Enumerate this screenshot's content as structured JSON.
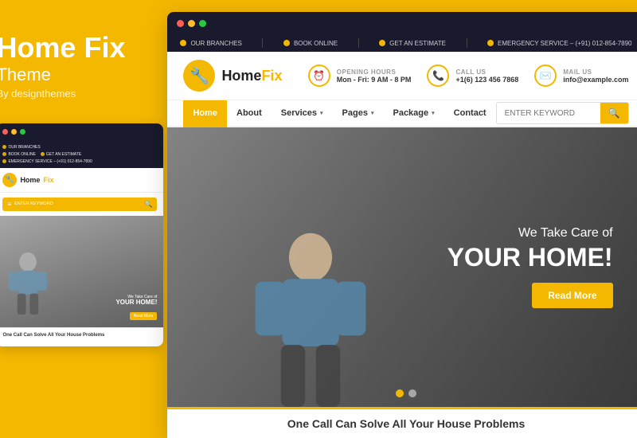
{
  "background_color": "#F5B800",
  "left": {
    "title": "Home Fix",
    "subtitle": "Theme",
    "by": "By designthemes"
  },
  "mini_browser": {
    "topbar": {
      "items": [
        {
          "icon": "location-icon",
          "text": "OUR BRANCHES"
        },
        {
          "icon": "book-icon",
          "text": "BOOK ONLINE"
        },
        {
          "icon": "estimate-icon",
          "text": "GET AN ESTIMATE"
        },
        {
          "icon": "emergency-icon",
          "text": "EMERGENCY SERVICE – (+91) 012-854-7890"
        }
      ]
    },
    "logo": "HomeFix",
    "search_placeholder": "ENTER KEYWORD",
    "hero": {
      "small": "We Take Care of",
      "big": "YOUR HOME!",
      "btn": "Read More"
    },
    "bottom": "One Call Can Solve All Your House Problems"
  },
  "browser": {
    "topbar": {
      "items": [
        {
          "icon": "location-icon",
          "label": "OUR BRANCHES"
        },
        {
          "icon": "book-icon",
          "label": "BOOK ONLINE"
        },
        {
          "icon": "estimate-icon",
          "label": "GET AN ESTIMATE"
        },
        {
          "icon": "phone-icon",
          "label": "EMERGENCY SERVICE – (+91) 012-854-7890"
        }
      ]
    },
    "header": {
      "logo_text_1": "Home",
      "logo_text_2": "Fix",
      "info_items": [
        {
          "icon": "clock-icon",
          "label": "OPENING HOURS",
          "value": "Mon - Fri: 9 AM - 8 PM"
        },
        {
          "icon": "phone-icon",
          "label": "CALL US",
          "value": "+1(6) 123 456 7868"
        },
        {
          "icon": "mail-icon",
          "label": "MAIL US",
          "value": "info@example.com"
        }
      ]
    },
    "nav": {
      "items": [
        {
          "label": "Home",
          "active": true,
          "has_dropdown": false
        },
        {
          "label": "About",
          "active": false,
          "has_dropdown": false
        },
        {
          "label": "Services",
          "active": false,
          "has_dropdown": true
        },
        {
          "label": "Pages",
          "active": false,
          "has_dropdown": true
        },
        {
          "label": "Package",
          "active": false,
          "has_dropdown": true
        },
        {
          "label": "Contact",
          "active": false,
          "has_dropdown": false
        }
      ],
      "search_placeholder": "ENTER KEYWORD"
    },
    "hero": {
      "small_text": "We Take Care of",
      "big_text": "YOUR HOME!",
      "btn_label": "Read More",
      "dots": 2,
      "active_dot": 0
    },
    "bottom_text": "One Call Can Solve All Your House Problems"
  }
}
